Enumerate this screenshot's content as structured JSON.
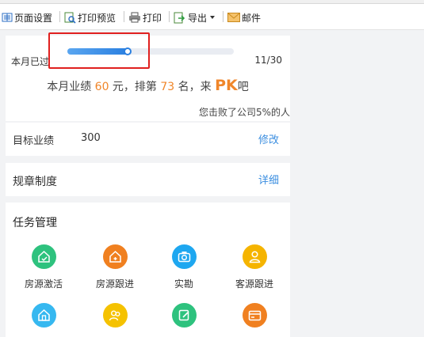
{
  "toolbar": {
    "items": [
      {
        "label": "页面设置",
        "icon": "page-setup-icon"
      },
      {
        "label": "打印预览",
        "icon": "print-preview-icon"
      },
      {
        "label": "打印",
        "icon": "printer-icon"
      },
      {
        "label": "导出",
        "icon": "export-icon"
      },
      {
        "label": "邮件",
        "icon": "mail-icon"
      }
    ]
  },
  "progress": {
    "label": "本月已过",
    "count": "11/30",
    "fraction": 0.367,
    "color": "#2a7fe0"
  },
  "performance": {
    "prefix": "本月业绩 ",
    "amount": "60",
    "mid": " 元，排第 ",
    "rank": "73",
    "mid2": " 名，来 ",
    "pk": "PK",
    "suffix": "吧",
    "accent": "#f0862a"
  },
  "beat_text": "您击败了公司5%的人",
  "target": {
    "label": "目标业绩",
    "value": "300",
    "action": "修改"
  },
  "rules": {
    "label": "规章制度",
    "action": "详细"
  },
  "tasks": {
    "title": "任务管理",
    "items": [
      {
        "label": "房源激活",
        "color": "#2ec27e",
        "icon": "house-activate-icon"
      },
      {
        "label": "房源跟进",
        "color": "#f08020",
        "icon": "house-followup-icon"
      },
      {
        "label": "实勘",
        "color": "#1ea7f0",
        "icon": "camera-icon"
      },
      {
        "label": "客源跟进",
        "color": "#f5b400",
        "icon": "client-followup-icon"
      },
      {
        "label": "",
        "color": "#36b8f0",
        "icon": "house-icon"
      },
      {
        "label": "",
        "color": "#f5c200",
        "icon": "people-icon"
      },
      {
        "label": "",
        "color": "#2ec27e",
        "icon": "edit-icon"
      },
      {
        "label": "",
        "color": "#f08020",
        "icon": "card-icon"
      }
    ]
  }
}
